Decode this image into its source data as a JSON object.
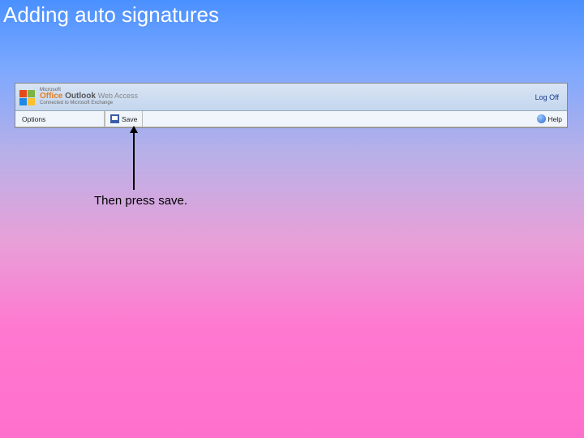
{
  "slide": {
    "title": "Adding auto signatures"
  },
  "owa": {
    "brand": {
      "microsoft": "Microsoft",
      "office": "Office",
      "outlook": "Outlook",
      "web_access": "Web Access",
      "connected": "Connected to Microsoft Exchange"
    },
    "logoff_label": "Log Off",
    "toolbar": {
      "options_label": "Options",
      "save_label": "Save",
      "help_label": "Help"
    }
  },
  "annotation": {
    "text": "Then press save."
  }
}
